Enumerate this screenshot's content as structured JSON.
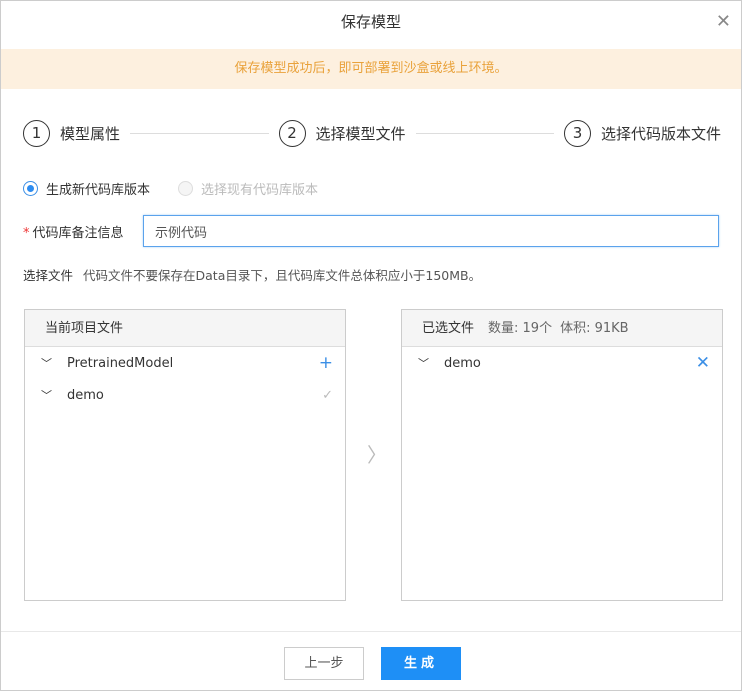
{
  "title": "保存模型",
  "notice": "保存模型成功后，即可部署到沙盒或线上环境。",
  "steps": [
    {
      "num": "1",
      "label": "模型属性"
    },
    {
      "num": "2",
      "label": "选择模型文件"
    },
    {
      "num": "3",
      "label": "选择代码版本文件"
    }
  ],
  "radios": {
    "new": "生成新代码库版本",
    "existing": "选择现有代码库版本"
  },
  "field": {
    "required": "*",
    "label": "代码库备注信息",
    "value": "示例代码"
  },
  "file_hint": {
    "label": "选择文件",
    "text": "代码文件不要保存在Data目录下，且代码库文件总体积应小于150MB。"
  },
  "left_panel": {
    "title": "当前项目文件",
    "items": [
      {
        "name": "PretrainedModel",
        "action": "+"
      },
      {
        "name": "demo",
        "action": "✓"
      }
    ]
  },
  "right_panel": {
    "title": "已选文件",
    "count": "数量: 19个",
    "size": "体积: 91KB",
    "items": [
      {
        "name": "demo",
        "action": "✕"
      }
    ]
  },
  "buttons": {
    "prev": "上一步",
    "generate": "生成"
  }
}
